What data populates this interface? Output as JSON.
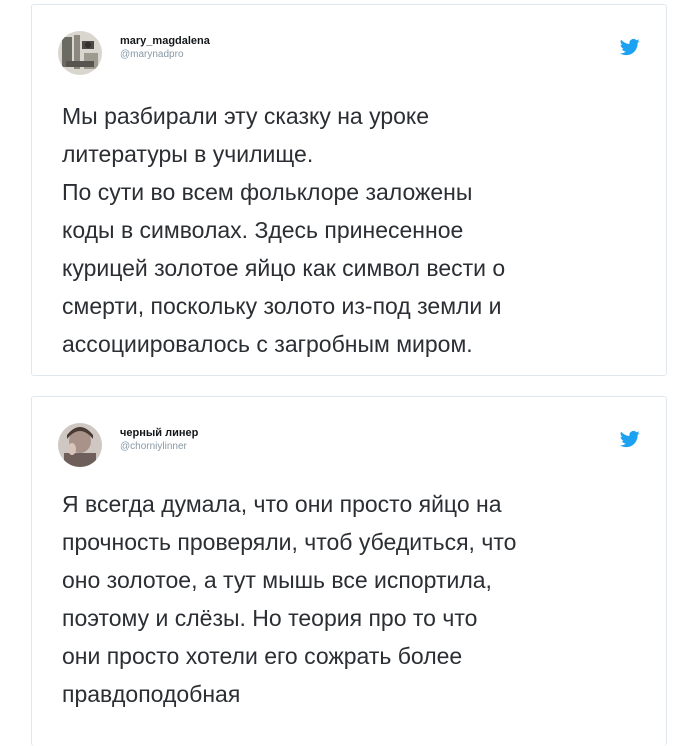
{
  "tweets": [
    {
      "display_name": "mary_magdalena",
      "handle": "@marynadpro",
      "text": "Мы разбирали эту сказку на уроке\nлитературы в училище.\nПо сути во всем фольклоре заложены\nкоды в символах. Здесь принесенное\nкурицей золотое яйцо как символ вести о\nсмерти, поскольку золото из-под земли и\nассоциировалось с загробным миром.",
      "icon": "twitter-bird-icon"
    },
    {
      "display_name": "черный линер",
      "handle": "@chorniylinner",
      "text": "Я всегда думала, что они просто яйцо на\nпрочность проверяли, чтоб убедиться, что\nоно золотое, а тут мышь все испортила,\nпоэтому и слёзы. Но теория про то что\nони просто хотели его сожрать более\nправдоподобная",
      "icon": "twitter-bird-icon"
    }
  ],
  "colors": {
    "twitter_blue": "#1da1f2",
    "border": "#e1e8ed",
    "text": "#2b2f33",
    "handle": "#8899a6"
  }
}
